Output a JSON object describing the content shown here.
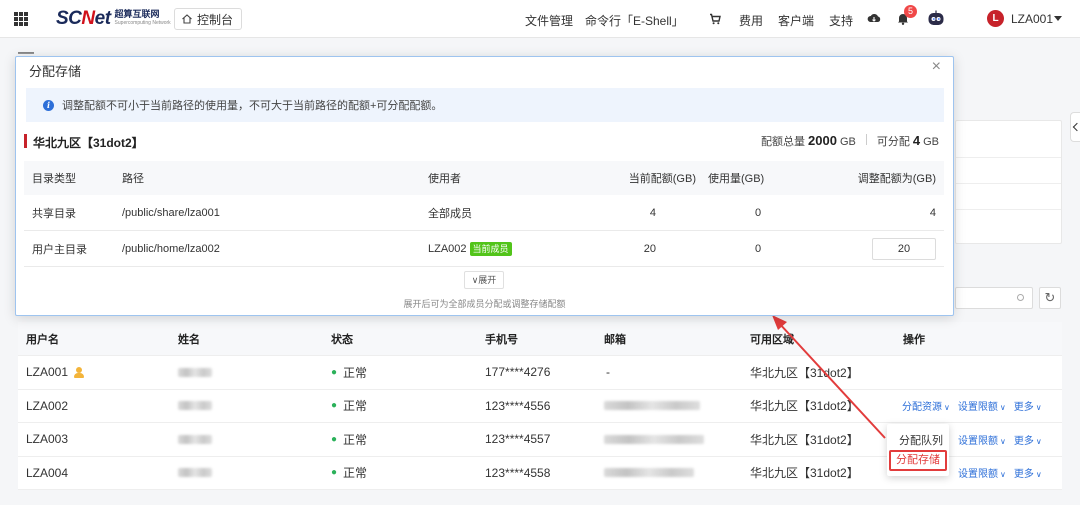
{
  "header": {
    "logo_main": "SCNet",
    "logo_cn": "超算互联网",
    "logo_en": "Supercomputing Network",
    "console_label": "控制台",
    "nav": {
      "files": "文件管理",
      "shell": "命令行「E-Shell」",
      "cart_icon": "cart-icon",
      "billing": "费用",
      "client": "客户端",
      "support": "支持",
      "cloud_icon": "cloud-download-icon",
      "bell_icon": "bell-icon",
      "notification_count": "5",
      "robot_icon": "robot-icon"
    },
    "user": {
      "avatar_letter": "L",
      "name": "LZA001"
    },
    "colors": {
      "brand_red": "#c7222a",
      "link_blue": "#2d6fd8"
    }
  },
  "modal": {
    "title": "分配存储",
    "close": "×",
    "notice": "调整配额不可小于当前路径的使用量，不可大于当前路径的配额+可分配配额。",
    "region": "华北九区【31dot2】",
    "quota_total_label": "配额总量",
    "quota_total_value": "2000",
    "quota_total_unit": "GB",
    "quota_avail_label": "可分配",
    "quota_avail_value": "4",
    "quota_avail_unit": "GB",
    "columns": [
      "目录类型",
      "路径",
      "使用者",
      "当前配额(GB)",
      "使用量(GB)",
      "调整配额为(GB)"
    ],
    "rows": [
      {
        "type": "共享目录",
        "path": "/public/share/lza001",
        "user": "全部成员",
        "tag": "",
        "quota": "4",
        "used": "0",
        "adjust": "4"
      },
      {
        "type": "用户主目录",
        "path": "/public/home/lza002",
        "user": "LZA002",
        "tag": "当前成员",
        "quota": "20",
        "used": "0",
        "adjust": "20"
      }
    ],
    "expand_label": "展开",
    "expand_hint": "展开后可为全部成员分配或调整存储配额"
  },
  "user_table": {
    "columns": [
      "用户名",
      "姓名",
      "状态",
      "手机号",
      "邮箱",
      "可用区域",
      "操作"
    ],
    "rows": [
      {
        "username": "LZA001",
        "status": "正常",
        "phone": "177****4276",
        "email": "-",
        "region": "华北九区【31dot2】"
      },
      {
        "username": "LZA002",
        "status": "正常",
        "phone": "123****4556",
        "email": "",
        "region": "华北九区【31dot2】"
      },
      {
        "username": "LZA003",
        "status": "正常",
        "phone": "123****4557",
        "email": "",
        "region": "华北九区【31dot2】"
      },
      {
        "username": "LZA004",
        "status": "正常",
        "phone": "123****4558",
        "email": "",
        "region": "华北九区【31dot2】"
      }
    ],
    "ops": {
      "alloc_resource": "分配资源",
      "set_limit": "设置限额",
      "more": "更多"
    }
  },
  "dropdown": {
    "item_queue": "分配队列",
    "item_storage": "分配存储"
  }
}
